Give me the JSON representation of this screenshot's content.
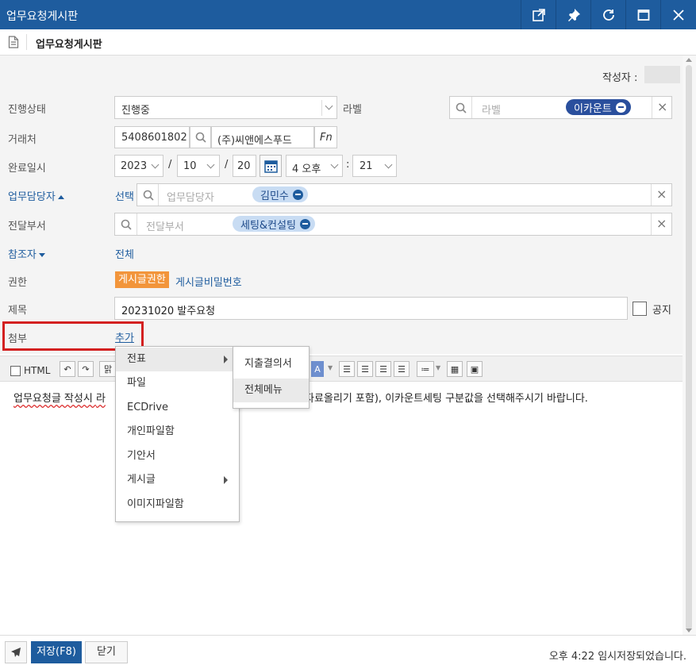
{
  "window": {
    "title": "업무요청게시판"
  },
  "page": {
    "title": "업무요청게시판"
  },
  "author": {
    "label": "작성자 :"
  },
  "form": {
    "status": {
      "label": "진행상태",
      "value": "진행중"
    },
    "label": {
      "label": "라벨",
      "placeholder": "라벨",
      "chip": "이카운트"
    },
    "client": {
      "label": "거래처",
      "code": "5408601802",
      "name": "(주)씨앤에스푸드",
      "fn": "Fn"
    },
    "due": {
      "label": "완료일시",
      "year": "2023",
      "sep1": "/",
      "month": "10",
      "sep2": "/",
      "day": "20",
      "hour": "4 오후",
      "colon": ":",
      "minute": "21"
    },
    "assignee": {
      "label": "업무담당자",
      "select": "선택",
      "placeholder": "업무담당자",
      "chip": "김민수"
    },
    "dept": {
      "label": "전달부서",
      "placeholder": "전달부서",
      "chip": "세팅&컨설팅"
    },
    "cc": {
      "label": "참조자",
      "value": "전체"
    },
    "perm": {
      "label": "권한",
      "badge": "게시글권한",
      "link": "게시글비밀번호"
    },
    "subject": {
      "label": "제목",
      "value": "20231020 발주요청",
      "notice": "공지"
    },
    "attach": {
      "label": "첨부",
      "add": "추가"
    }
  },
  "toolbar": {
    "html": "HTML",
    "font_stub": "맑"
  },
  "editor": {
    "line_before": "업무요청글 작성시 ",
    "line_start_tail": "라",
    "line_after_hidden": "자료올리기 포함), 이카운트세팅  구분값을 선택해주시기 바랍니다."
  },
  "menu": {
    "items": [
      "전표",
      "파일",
      "ECDrive",
      "개인파일함",
      "기안서",
      "게시글",
      "이미지파일함"
    ],
    "submenu": [
      "지출결의서",
      "전체메뉴"
    ]
  },
  "footer": {
    "save": "저장(F8)",
    "close": "닫기",
    "status": "오후 4:22 임시저장되었습니다."
  },
  "colors": {
    "primary": "#1e5c9e",
    "accent_orange": "#f2953b",
    "highlight_red": "#d32020"
  }
}
